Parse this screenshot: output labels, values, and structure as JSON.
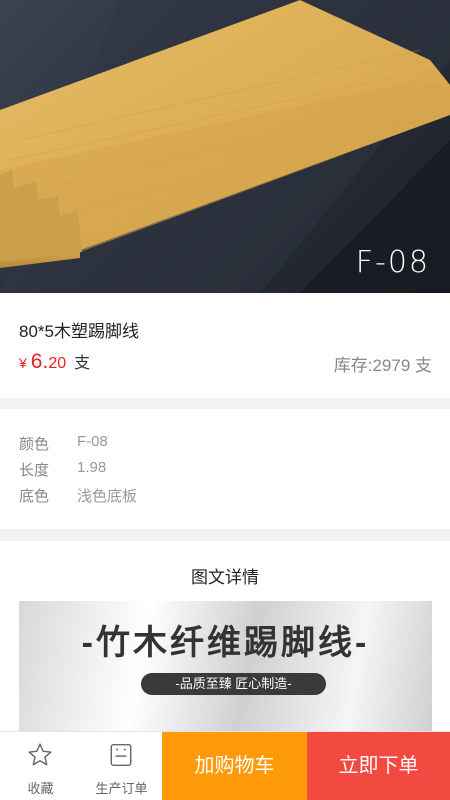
{
  "hero": {
    "code": "F-08"
  },
  "product": {
    "title": "80*5木塑踢脚线",
    "currency": "¥",
    "price_int": "6.",
    "price_dec": "20",
    "price_unit": "支",
    "stock": "库存:2979 支"
  },
  "specs": [
    {
      "key": "颜色",
      "value": "F-08"
    },
    {
      "key": "长度",
      "value": "1.98"
    },
    {
      "key": "底色",
      "value": "浅色底板"
    }
  ],
  "details": {
    "title": "图文详情",
    "banner_title": "-竹木纤维踢脚线-",
    "banner_sub": "-品质至臻 匠心制造-"
  },
  "bottom_bar": {
    "favorite_label": "收藏",
    "orders_label": "生产订单",
    "cart_label": "加购物车",
    "buy_label": "立即下单"
  },
  "colors": {
    "price": "#e8221d",
    "cart": "#ff9a0a",
    "buy": "#f24a40",
    "wood": "#e0b45c"
  }
}
